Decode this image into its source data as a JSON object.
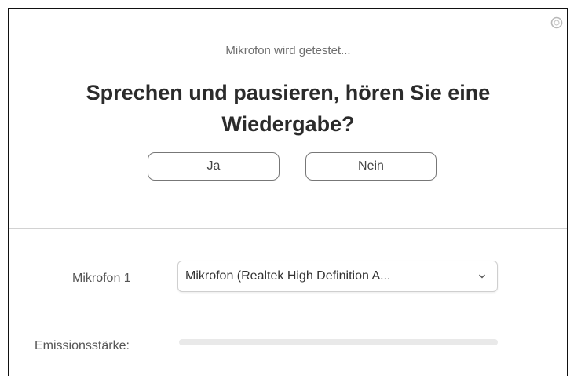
{
  "dialog": {
    "subtitle": "Mikrofon wird getestet...",
    "question": "Sprechen und pausieren, hören Sie eine Wiedergabe?",
    "close_icon": "close-icon",
    "buttons": {
      "yes_label": "Ja",
      "no_label": "Nein"
    }
  },
  "settings": {
    "microphone_label": "Mikrofon 1",
    "microphone_value": "Mikrofon (Realtek High Definition A...",
    "dropdown_icon": "chevron-down-icon",
    "level_label": "Emissionsstärke:",
    "level_value": 0
  },
  "colors": {
    "title_text": "#2b2b2b",
    "subtle_text": "#6e6e6e",
    "divider": "#d2d2d2",
    "level_track": "#e9e9e9"
  }
}
